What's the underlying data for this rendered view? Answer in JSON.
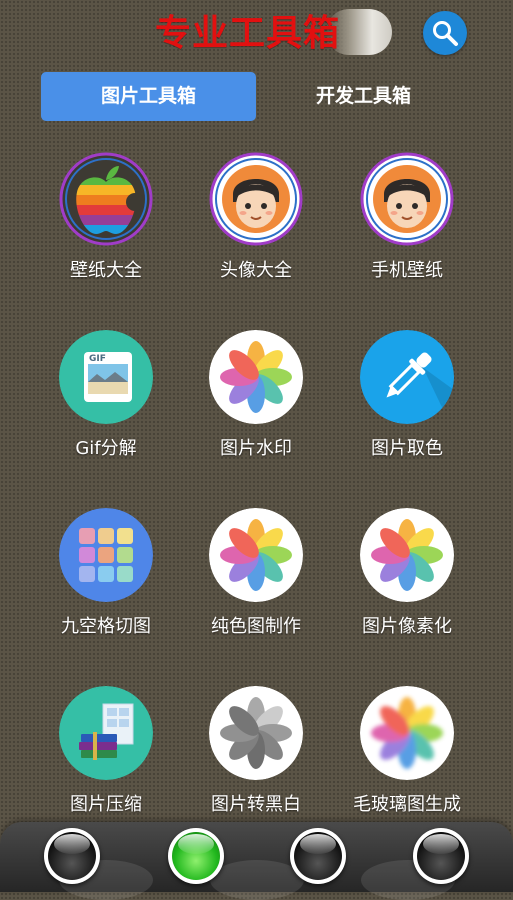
{
  "header": {
    "title": "专业工具箱",
    "search_icon": "search-icon"
  },
  "tabs": [
    {
      "label": "图片工具箱",
      "active": true
    },
    {
      "label": "开发工具箱",
      "active": false
    }
  ],
  "grid": {
    "items": [
      {
        "label": "壁纸大全",
        "icon": "rainbow-apple-icon"
      },
      {
        "label": "头像大全",
        "icon": "boy-avatar-icon"
      },
      {
        "label": "手机壁纸",
        "icon": "boy-avatar-icon"
      },
      {
        "label": "Gif分解",
        "icon": "gif-image-icon"
      },
      {
        "label": "图片水印",
        "icon": "photos-flower-icon"
      },
      {
        "label": "图片取色",
        "icon": "eyedropper-icon"
      },
      {
        "label": "九空格切图",
        "icon": "nine-grid-icon"
      },
      {
        "label": "纯色图制作",
        "icon": "photos-flower-icon"
      },
      {
        "label": "图片像素化",
        "icon": "photos-flower-icon"
      },
      {
        "label": "图片压缩",
        "icon": "books-archive-icon"
      },
      {
        "label": "图片转黑白",
        "icon": "grayscale-flower-icon"
      },
      {
        "label": "毛玻璃图生成",
        "icon": "blurred-flower-icon"
      }
    ]
  },
  "dock": {
    "lights": [
      {
        "state": "off"
      },
      {
        "state": "on"
      },
      {
        "state": "off"
      },
      {
        "state": "off"
      }
    ]
  },
  "colors": {
    "title_red": "#e21010",
    "active_tab_blue": "#4a90e8",
    "search_blue": "#1e88d8",
    "teal_icon_bg": "#35bfa6",
    "light_on_green": "#22b81e"
  }
}
